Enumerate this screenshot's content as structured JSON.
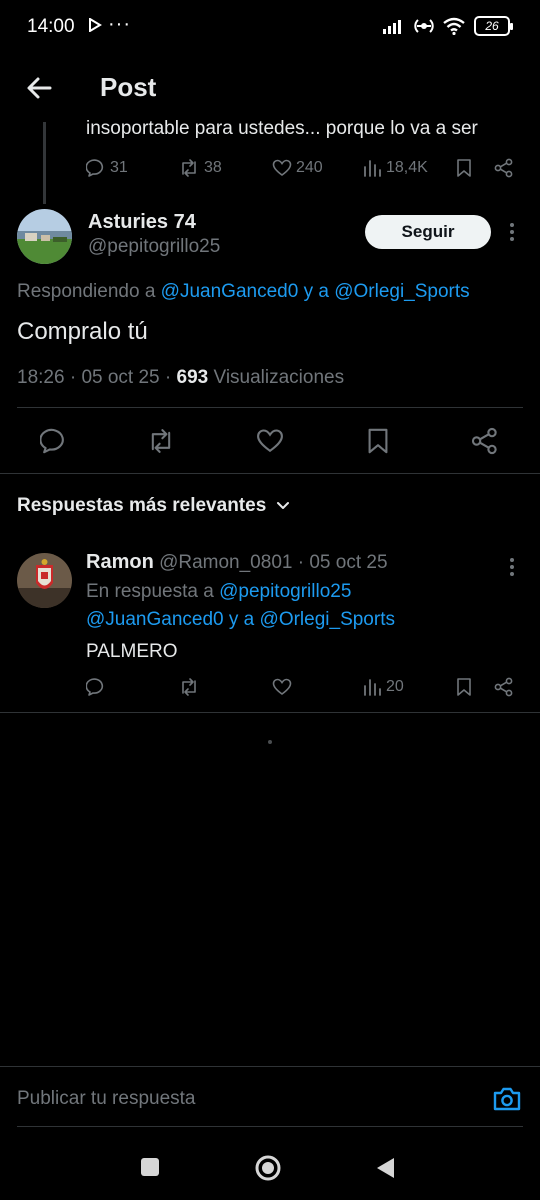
{
  "status_bar": {
    "time": "14:00",
    "dots": "···",
    "battery": "26",
    "icons": [
      "play-indicator-icon",
      "signal-icon",
      "hotspot-icon",
      "wifi-icon",
      "battery-icon"
    ]
  },
  "header": {
    "title": "Post",
    "back_icon": "arrow-left-icon"
  },
  "parent_tweet": {
    "text_fragment": "insoportable para ustedes... porque lo va a ser",
    "replies": "31",
    "reposts": "38",
    "likes": "240",
    "views": "18,4K"
  },
  "main_tweet": {
    "display_name": "Asturies 74",
    "handle": "@pepitogrillo25",
    "follow_label": "Seguir",
    "replying_prefix": "Respondiendo a",
    "replying_user1": "@JuanGanced0",
    "replying_joiner": "y a",
    "replying_user2": "@Orlegi_Sports",
    "text": "Compralo tú",
    "time": "18:26",
    "date": "05 oct 25",
    "separator": "·",
    "views_count": "693",
    "views_label": "Visualizaciones"
  },
  "replies_section": {
    "sort_label": "Respuestas más relevantes"
  },
  "reply": {
    "display_name": "Ramon",
    "handle": "@Ramon_0801",
    "date": "05 oct 25",
    "separator": "·",
    "in_reply_prefix": "En respuesta a",
    "in_reply_user1": "@pepitogrillo25",
    "in_reply_user2": "@JuanGanced0",
    "in_reply_joiner": "y a",
    "in_reply_user3": "@Orlegi_Sports",
    "text": "PALMERO",
    "views": "20"
  },
  "composer": {
    "placeholder": "Publicar tu respuesta"
  },
  "colors": {
    "background": "#000000",
    "text": "#e7e9ea",
    "muted": "#71767b",
    "link": "#1d9bf0",
    "divider": "#2f3336"
  }
}
